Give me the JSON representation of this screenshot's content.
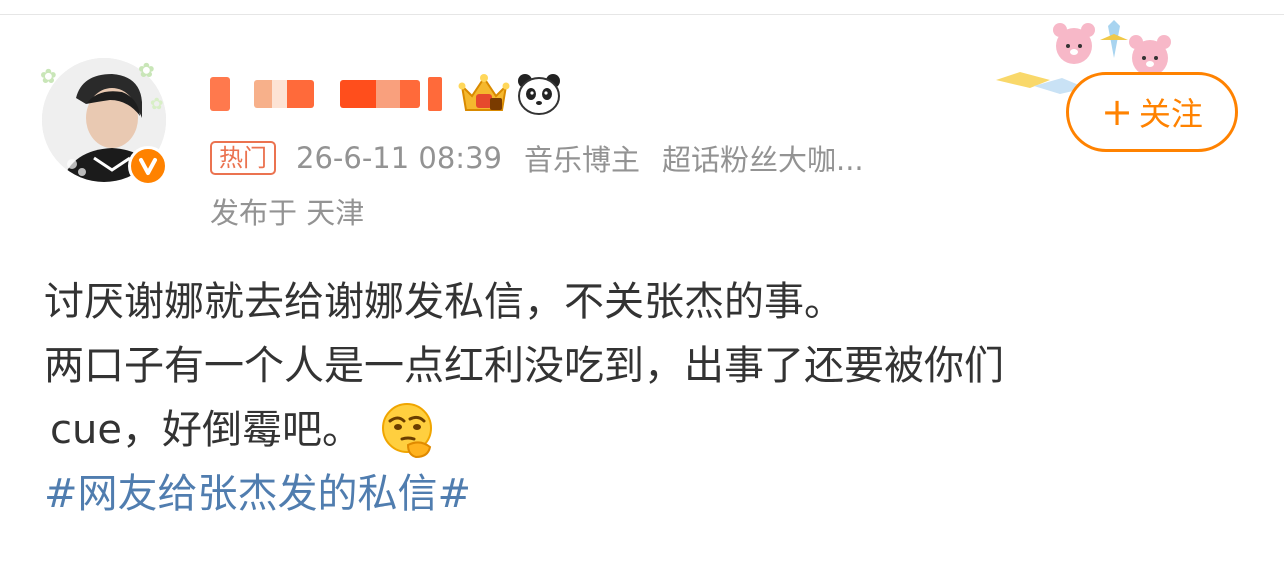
{
  "user": {
    "verified_badge_icon": "verified-v-icon",
    "level_badge_icon": "crown-icon",
    "extra_badge_icon": "panda-icon"
  },
  "meta": {
    "hot_label": "热门",
    "timestamp": "26-6-11 08:39",
    "tag1": "音乐博主",
    "tag2": "超话粉丝大咖...",
    "location": "发布于 天津"
  },
  "follow": {
    "plus": "+",
    "label": "关注"
  },
  "post": {
    "line1": "讨厌谢娜就去给谢娜发私信，不关张杰的事。",
    "line2": "两口子有一个人是一点红利没吃到，出事了还要被你们",
    "line3": "cue，好倒霉吧。",
    "emoji": "thinking-face-emoji",
    "hashtag": "#网友给张杰发的私信#"
  },
  "colors": {
    "accent": "#ff8200",
    "hot": "#eb7350",
    "link": "#507daf",
    "meta_text": "#939393"
  }
}
